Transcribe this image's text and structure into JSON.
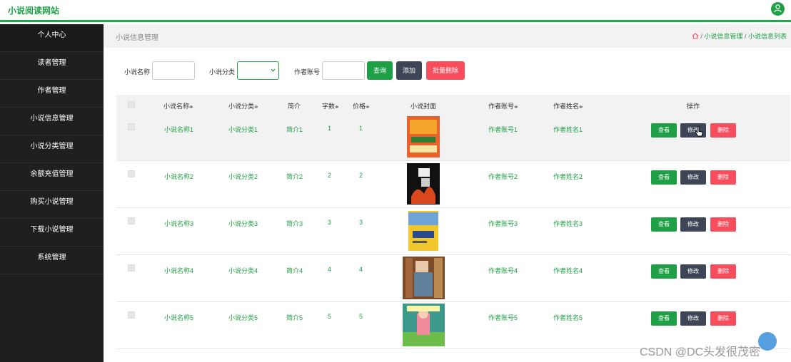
{
  "app": {
    "title": "小说阅读网站",
    "user_icon": "user-avatar-icon"
  },
  "sidebar": {
    "items": [
      "个人中心",
      "读者管理",
      "作者管理",
      "小说信息管理",
      "小说分类管理",
      "余额充值管理",
      "购买小说管理",
      "下载小说管理",
      "系统管理"
    ]
  },
  "header": {
    "page_title": "小说信息管理",
    "breadcrumb": {
      "home_icon": "home-icon",
      "sep": "/",
      "level1": "小说信息管理",
      "level2": "小说信息列表"
    }
  },
  "search": {
    "name_label": "小说名称",
    "name_value": "",
    "category_label": "小说分类",
    "category_value": "",
    "author_label": "作者账号",
    "author_value": "",
    "query_button": "查询",
    "add_button": "添加",
    "batch_delete_button": "批量删除"
  },
  "table": {
    "columns": [
      "小说名称",
      "小说分类",
      "简介",
      "字数",
      "价格",
      "小说封面",
      "作者账号",
      "作者姓名",
      "操作"
    ],
    "sort_glyph": "≑",
    "rows": [
      {
        "name": "小说名称1",
        "category": "小说分类1",
        "intro": "简介1",
        "words": "1",
        "price": "1",
        "account": "作者账号1",
        "author": "作者姓名1"
      },
      {
        "name": "小说名称2",
        "category": "小说分类2",
        "intro": "简介2",
        "words": "2",
        "price": "2",
        "account": "作者账号2",
        "author": "作者姓名2"
      },
      {
        "name": "小说名称3",
        "category": "小说分类3",
        "intro": "简介3",
        "words": "3",
        "price": "3",
        "account": "作者账号3",
        "author": "作者姓名3"
      },
      {
        "name": "小说名称4",
        "category": "小说分类4",
        "intro": "简介4",
        "words": "4",
        "price": "4",
        "account": "作者账号4",
        "author": "作者姓名4"
      },
      {
        "name": "小说名称5",
        "category": "小说分类5",
        "intro": "简介5",
        "words": "5",
        "price": "5",
        "account": "作者账号5",
        "author": "作者姓名5"
      }
    ],
    "actions": {
      "view": "查看",
      "edit": "修改",
      "delete": "删除"
    }
  },
  "watermark": "CSDN @DC头发很茂密",
  "colors": {
    "primary": "#1fa046",
    "slate": "#3e4556",
    "danger": "#f84d5c",
    "sidebar": "#1f1f1f"
  }
}
